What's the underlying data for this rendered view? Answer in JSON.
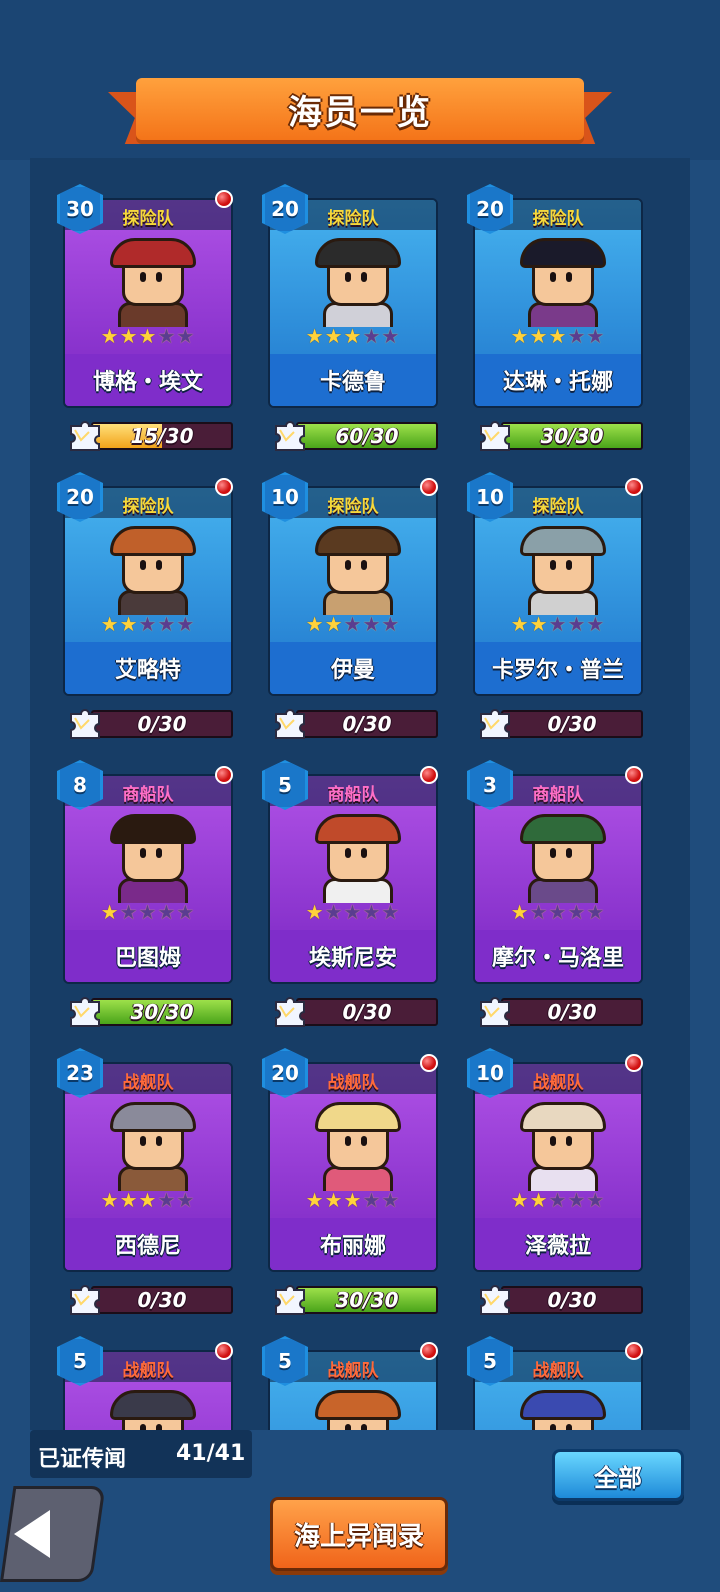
{
  "title": "海员一览",
  "colors": {
    "background": "#1f4c7c",
    "banner": "#f47419",
    "card_blue": "#1f76cc",
    "card_purple": "#7a27c3",
    "progress_green": "#4aa41a",
    "progress_yellow": "#f2a21a",
    "team_explore": "#f6d83a",
    "team_merchant": "#ff6fc7",
    "team_warship": "#ff6a3a"
  },
  "cards": [
    {
      "level": "30",
      "team": "探险队",
      "team_type": "exp",
      "name": "博格・埃文",
      "stars": 3,
      "progress_text": "15/30",
      "progress_fraction": 0.5,
      "progress_color": "yellow",
      "card_color": "purple",
      "has_notification": true
    },
    {
      "level": "20",
      "team": "探险队",
      "team_type": "exp",
      "name": "卡德鲁",
      "stars": 3,
      "progress_text": "60/30",
      "progress_fraction": 1.0,
      "progress_color": "green",
      "card_color": "blue",
      "has_notification": false
    },
    {
      "level": "20",
      "team": "探险队",
      "team_type": "exp",
      "name": "达琳・托娜",
      "stars": 3,
      "progress_text": "30/30",
      "progress_fraction": 1.0,
      "progress_color": "green",
      "card_color": "blue",
      "has_notification": false
    },
    {
      "level": "20",
      "team": "探险队",
      "team_type": "exp",
      "name": "艾略特",
      "stars": 2,
      "progress_text": "0/30",
      "progress_fraction": 0,
      "progress_color": "green",
      "card_color": "blue",
      "has_notification": true
    },
    {
      "level": "10",
      "team": "探险队",
      "team_type": "exp",
      "name": "伊曼",
      "stars": 2,
      "progress_text": "0/30",
      "progress_fraction": 0,
      "progress_color": "green",
      "card_color": "blue",
      "has_notification": true
    },
    {
      "level": "10",
      "team": "探险队",
      "team_type": "exp",
      "name": "卡罗尔・普兰",
      "stars": 2,
      "progress_text": "0/30",
      "progress_fraction": 0,
      "progress_color": "green",
      "card_color": "blue",
      "has_notification": true
    },
    {
      "level": "8",
      "team": "商船队",
      "team_type": "mer",
      "name": "巴图姆",
      "stars": 1,
      "progress_text": "30/30",
      "progress_fraction": 1.0,
      "progress_color": "green",
      "card_color": "purple",
      "has_notification": true
    },
    {
      "level": "5",
      "team": "商船队",
      "team_type": "mer",
      "name": "埃斯尼安",
      "stars": 1,
      "progress_text": "0/30",
      "progress_fraction": 0,
      "progress_color": "green",
      "card_color": "purple",
      "has_notification": true
    },
    {
      "level": "3",
      "team": "商船队",
      "team_type": "mer",
      "name": "摩尔・马洛里",
      "stars": 1,
      "progress_text": "0/30",
      "progress_fraction": 0,
      "progress_color": "green",
      "card_color": "purple",
      "has_notification": true
    },
    {
      "level": "23",
      "team": "战舰队",
      "team_type": "war",
      "name": "西德尼",
      "stars": 3,
      "progress_text": "0/30",
      "progress_fraction": 0,
      "progress_color": "green",
      "card_color": "purple",
      "has_notification": false
    },
    {
      "level": "20",
      "team": "战舰队",
      "team_type": "war",
      "name": "布丽娜",
      "stars": 3,
      "progress_text": "30/30",
      "progress_fraction": 1.0,
      "progress_color": "green",
      "card_color": "purple",
      "has_notification": true
    },
    {
      "level": "10",
      "team": "战舰队",
      "team_type": "war",
      "name": "泽薇拉",
      "stars": 2,
      "progress_text": "0/30",
      "progress_fraction": 0,
      "progress_color": "green",
      "card_color": "purple",
      "has_notification": true
    },
    {
      "level": "5",
      "team": "战舰队",
      "team_type": "war",
      "name": "",
      "stars": 0,
      "progress_text": "",
      "progress_fraction": 0,
      "progress_color": "green",
      "card_color": "purple",
      "has_notification": true
    },
    {
      "level": "5",
      "team": "战舰队",
      "team_type": "war",
      "name": "",
      "stars": 0,
      "progress_text": "",
      "progress_fraction": 0,
      "progress_color": "green",
      "card_color": "blue",
      "has_notification": true
    },
    {
      "level": "5",
      "team": "战舰队",
      "team_type": "war",
      "name": "",
      "stars": 0,
      "progress_text": "",
      "progress_fraction": 0,
      "progress_color": "green",
      "card_color": "blue",
      "has_notification": true
    }
  ],
  "footer": {
    "counter_label": "已证传闻",
    "counter_value": "41/41",
    "all_button": "全部",
    "legend_button": "海上异闻录",
    "back_icon": "back-arrow-icon"
  }
}
